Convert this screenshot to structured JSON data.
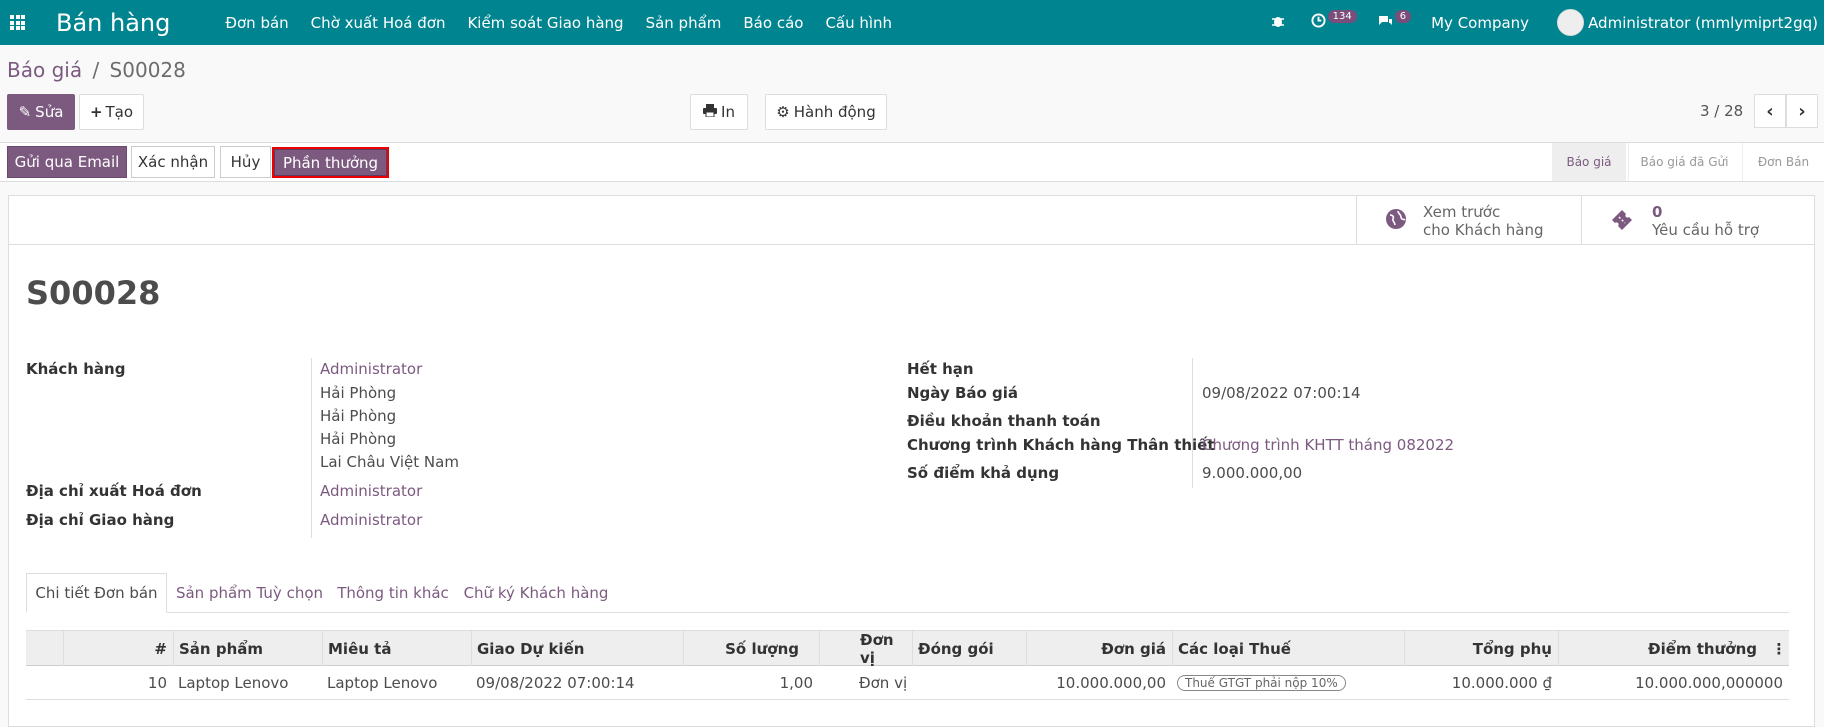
{
  "app": {
    "name": "Bán hàng"
  },
  "menu": [
    "Đơn bán",
    "Chờ xuất Hoá đơn",
    "Kiểm soát Giao hàng",
    "Sản phẩm",
    "Báo cáo",
    "Cấu hình"
  ],
  "topbar": {
    "activity_count": "134",
    "message_count": "6",
    "company": "My Company",
    "user": "Administrator (mmlymiprt2gq)"
  },
  "breadcrumb": {
    "parent": "Báo giá",
    "sep": "/",
    "current": "S00028"
  },
  "toolbar": {
    "edit": "Sửa",
    "create": "Tạo",
    "print": "In",
    "action": "Hành động"
  },
  "pager": {
    "text": "3 / 28"
  },
  "statusbar": {
    "buttons": [
      "Gửi qua Email",
      "Xác nhận",
      "Hủy",
      "Phần thưởng"
    ],
    "stages": [
      "Báo giá",
      "Báo giá đã Gửi",
      "Đơn Bán"
    ]
  },
  "smart": {
    "preview_line1": "Xem trước",
    "preview_line2": "cho Khách hàng",
    "tickets_count": "0",
    "tickets_label": "Yêu cầu hỗ trợ"
  },
  "record": {
    "name": "S00028",
    "customer_label": "Khách hàng",
    "customer": [
      "Administrator",
      "Hải Phòng",
      "Hải Phòng",
      "Hải Phòng",
      "Lai Châu Việt Nam"
    ],
    "invoice_addr_label": "Địa chỉ xuất Hoá đơn",
    "invoice_addr": "Administrator",
    "delivery_addr_label": "Địa chỉ Giao hàng",
    "delivery_addr": "Administrator",
    "expiry_label": "Hết hạn",
    "date_label": "Ngày Báo giá",
    "date": "09/08/2022 07:00:14",
    "terms_label": "Điều khoản thanh toán",
    "loyalty_label": "Chương trình Khách hàng Thân thiết",
    "loyalty": "Chương trình KHTT tháng 082022",
    "points_label": "Số điểm khả dụng",
    "points": "9.000.000,00"
  },
  "tabs": [
    "Chi tiết Đơn bán",
    "Sản phẩm Tuỳ chọn",
    "Thông tin khác",
    "Chữ ký Khách hàng"
  ],
  "table": {
    "headers": [
      "#",
      "Sản phẩm",
      "Miêu tả",
      "Giao Dự kiến",
      "Số lượng",
      "Đơn vị",
      "Đóng gói",
      "Đơn giá",
      "Các loại Thuế",
      "Tổng phụ",
      "Điểm thưởng"
    ],
    "rows": [
      [
        "10",
        "Laptop Lenovo",
        "Laptop Lenovo",
        "09/08/2022 07:00:14",
        "1,00",
        "Đơn vị",
        "",
        "10.000.000,00",
        "Thuế GTGT phải nộp 10%",
        "10.000.000 ₫",
        "10.000.000,000000"
      ]
    ]
  }
}
